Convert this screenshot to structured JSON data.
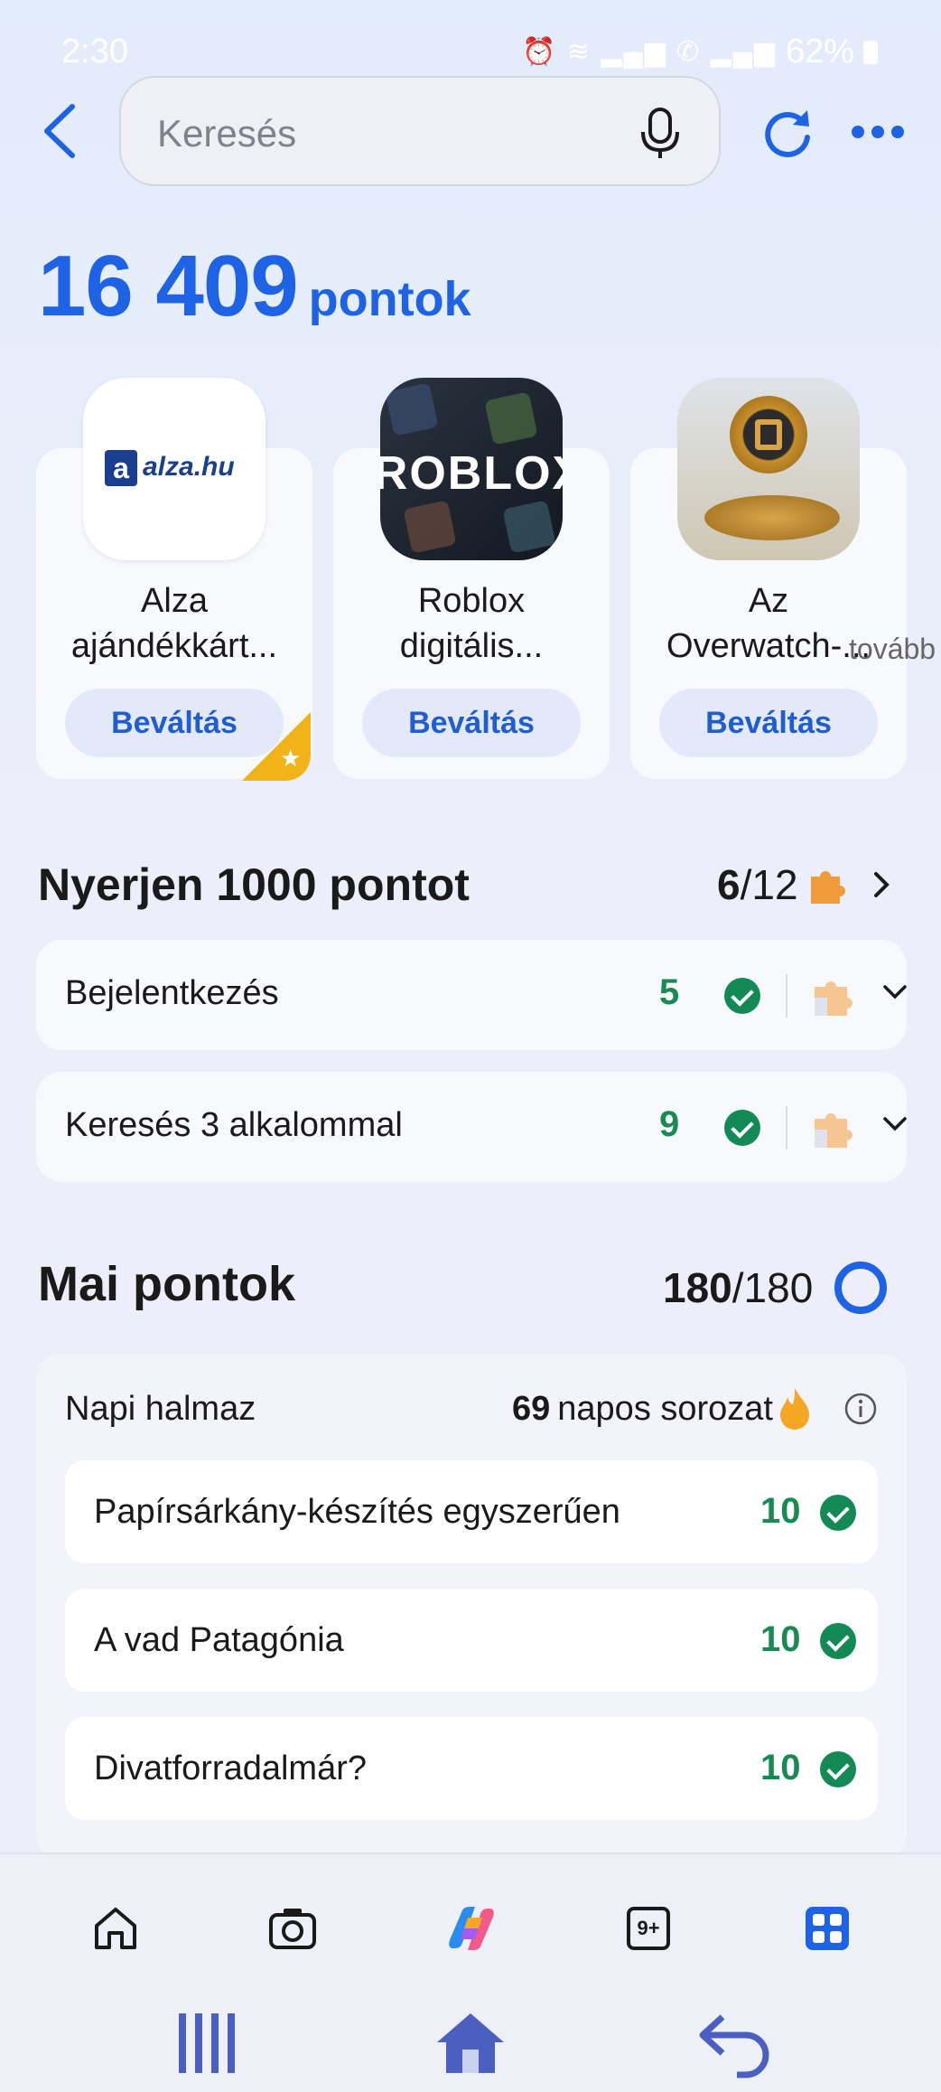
{
  "status": {
    "time": "2:30",
    "battery": "62%"
  },
  "search": {
    "placeholder": "Keresés"
  },
  "points": {
    "value": "16 409",
    "unit": "pontok"
  },
  "rewards": [
    {
      "title_line1": "Alza",
      "title_line2": "ajándékkárt...",
      "button": "Beváltás",
      "logo_text": "alza.hu"
    },
    {
      "title_line1": "Roblox",
      "title_line2": "digitális...",
      "button": "Beváltás",
      "logo_text": "ROBLOX"
    },
    {
      "title_line1": "Az",
      "title_line2": "Overwatch-...",
      "button": "Beváltás"
    }
  ],
  "more_label": "tovább",
  "challenge": {
    "title": "Nyerjen 1000 pontot",
    "progress_done": "6",
    "progress_total": "/12",
    "tasks": [
      {
        "label": "Bejelentkezés",
        "count": "5"
      },
      {
        "label": "Keresés 3 alkalommal",
        "count": "9"
      }
    ]
  },
  "daily_points": {
    "title": "Mai pontok",
    "earned": "180",
    "total": "/180",
    "progress": 1.0
  },
  "daily_set": {
    "title": "Napi halmaz",
    "streak_days": "69",
    "streak_label": "napos sorozat",
    "items": [
      {
        "label": "Papírsárkány-készítés egyszerűen",
        "points": "10"
      },
      {
        "label": "A vad Patagónia",
        "points": "10"
      },
      {
        "label": "Divatforradalmár?",
        "points": "10"
      }
    ]
  },
  "bottom_nav": {
    "icons": [
      "home-icon",
      "camera-icon",
      "copilot-icon",
      "tabs-icon",
      "apps-icon"
    ],
    "tabs_badge": "9+"
  },
  "colors": {
    "accent": "#1e62e6",
    "success": "#138a55",
    "puzzle": "#f29b3a"
  }
}
